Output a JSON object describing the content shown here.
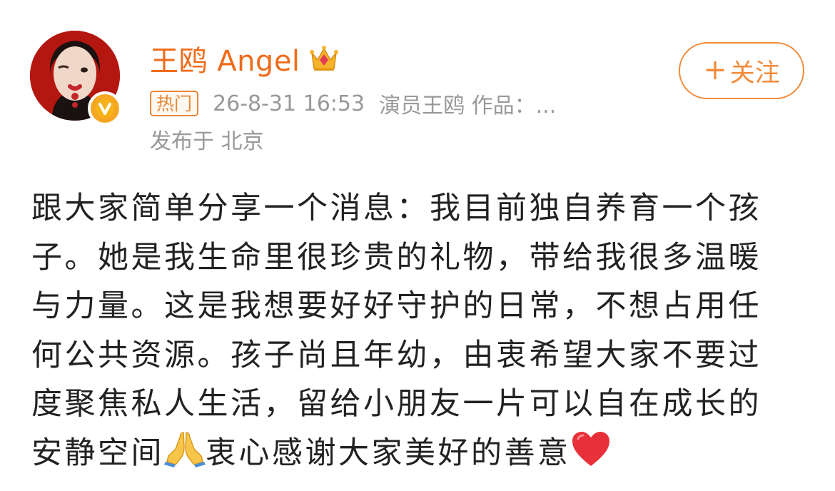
{
  "author": {
    "name": "王鸥 Angel",
    "avatar_icon": "avatar-photo",
    "badge_icon": "verified-v-badge",
    "crown_icon": "crown-icon"
  },
  "meta": {
    "tag": "热门",
    "timestamp": "26-8-31 16:53",
    "source": "演员王鸥 作品：...",
    "location": "发布于 北京"
  },
  "follow_button": {
    "plus": "+",
    "label": "关注"
  },
  "post": {
    "lines": [
      "跟大家简单分享一个消息：我目前独自养育一个孩",
      "子。她是我生命里很珍贵的礼物，带给我很多温暖",
      "与力量。这是我想要好好守护的日常，不想占用任",
      "何公共资源。孩子尚且年幼，由衷希望大家不要过",
      "度聚焦私人生活，留给小朋友一片可以自在成长的"
    ],
    "last_line_before_emoji": "安静空间",
    "last_line_after_emoji": "衷心感谢大家美好的善意",
    "emoji_1": "folded-hands-emoji",
    "emoji_2": "red-heart-emoji"
  },
  "colors": {
    "accent": "#ef6b1a",
    "follow": "#f28b3b",
    "meta_gray": "#999999",
    "badge": "#f5a623"
  }
}
